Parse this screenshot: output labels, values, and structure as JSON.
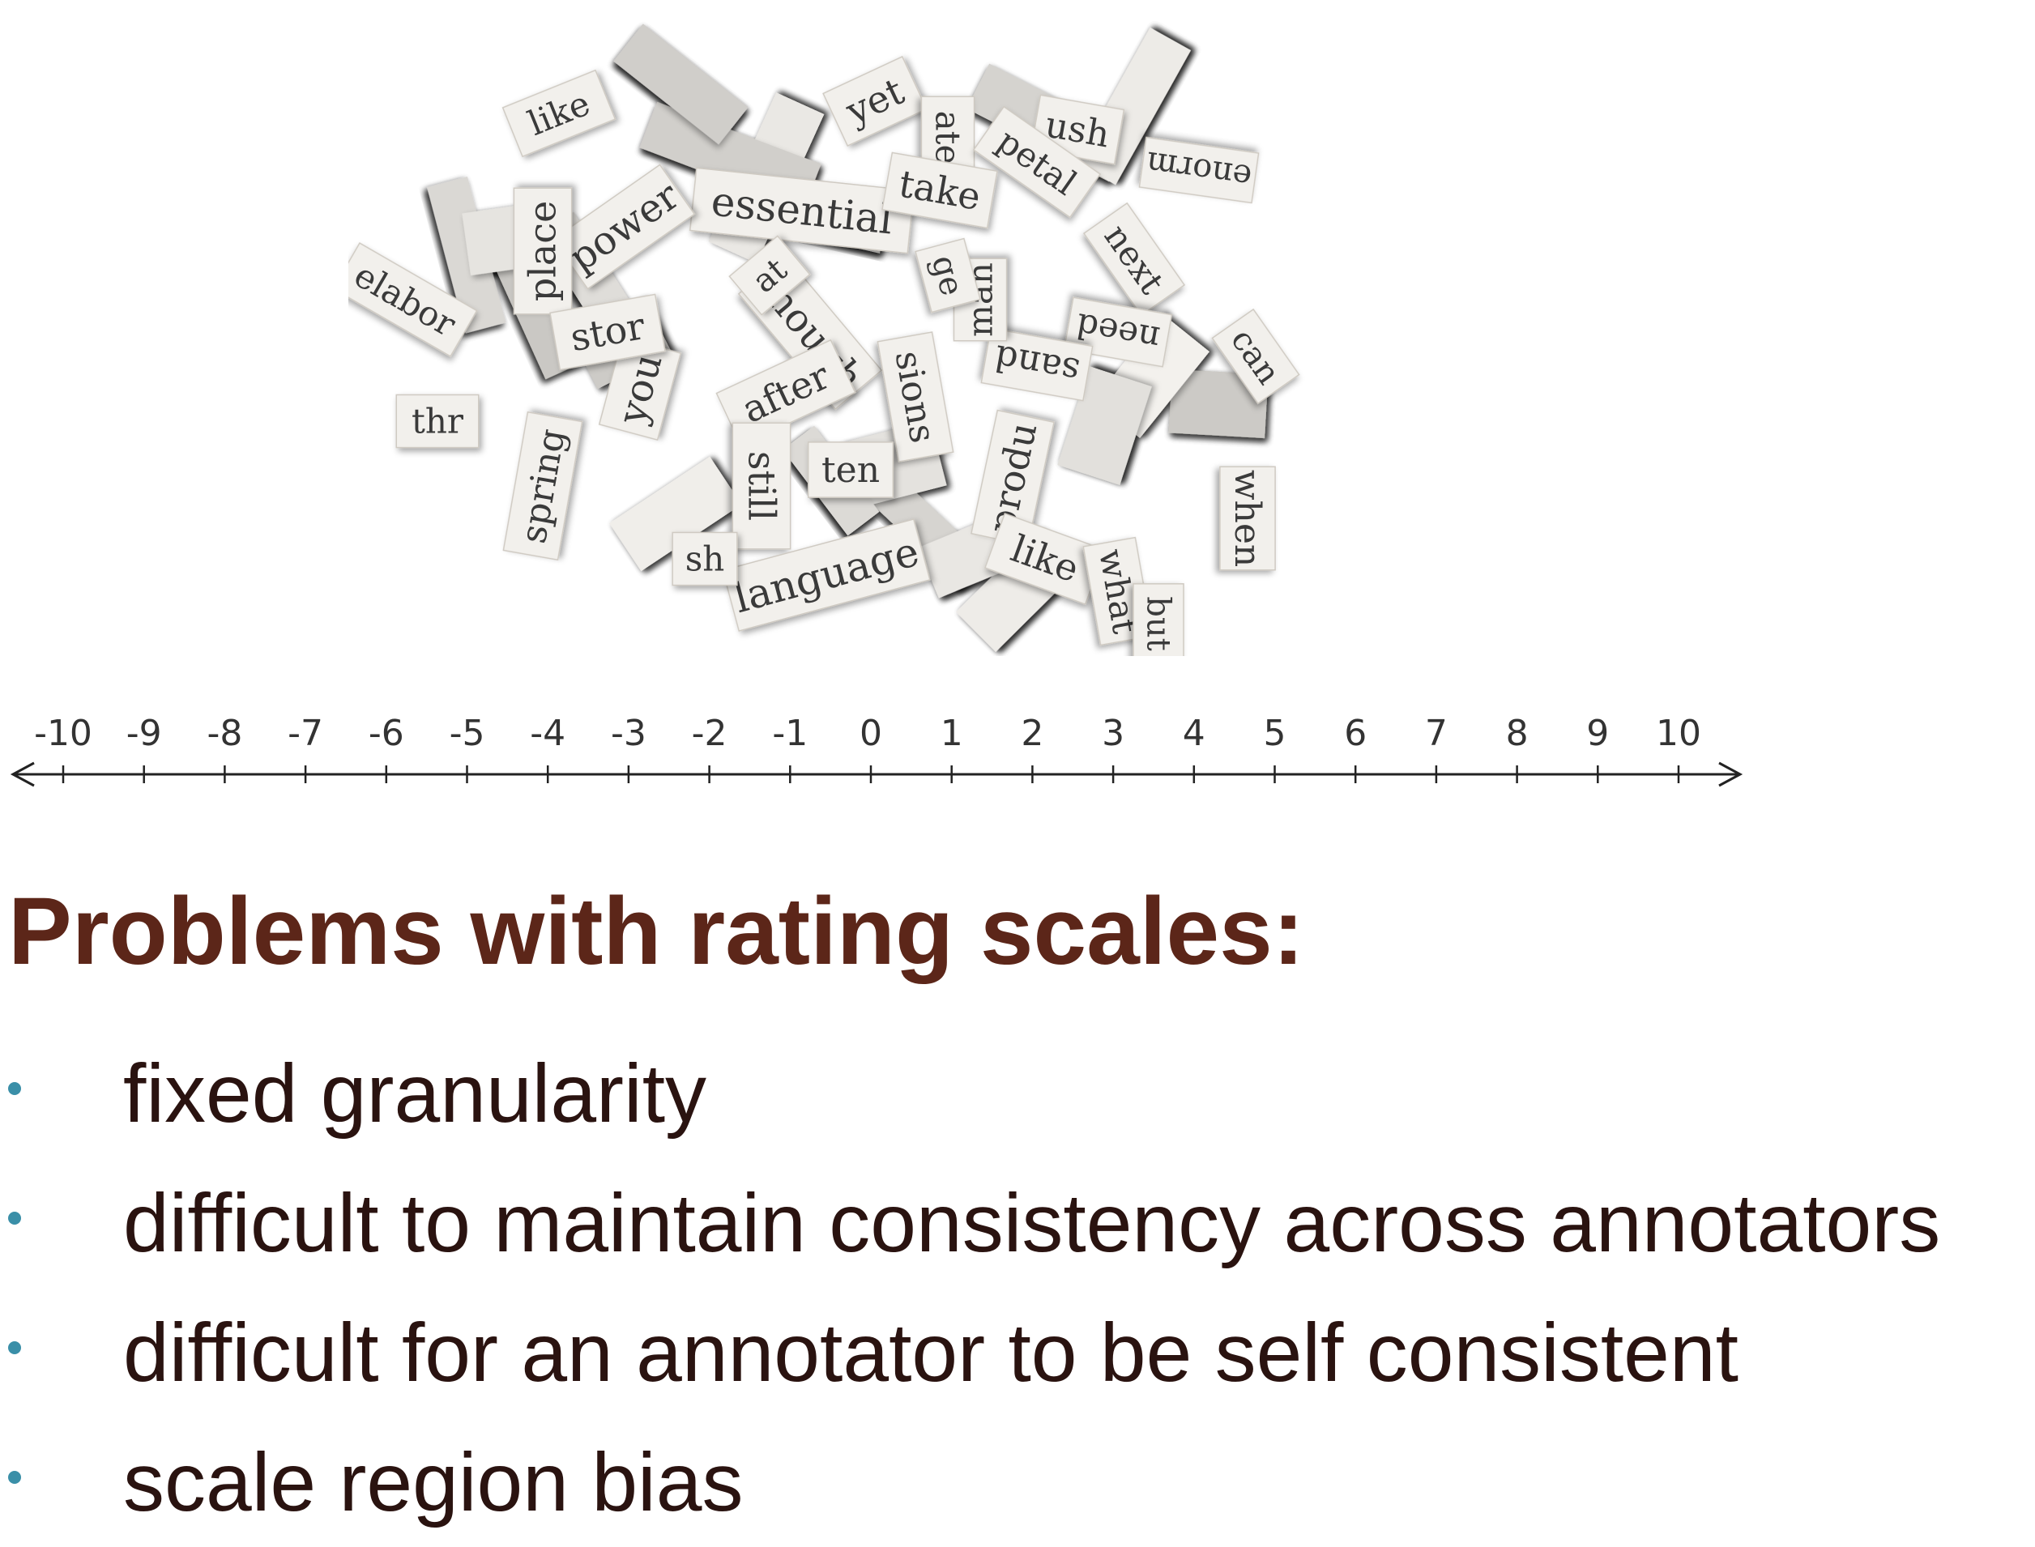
{
  "image": {
    "words": [
      "yet",
      "like",
      "ush",
      "ate",
      "petal",
      "enorm",
      "essential",
      "take",
      "power",
      "place",
      "next",
      "need",
      "can",
      "elabor",
      "though",
      "at",
      "you",
      "stor",
      "after",
      "sions",
      "sand",
      "man",
      "ten",
      "still",
      "produ",
      "when",
      "ge",
      "spring",
      "language",
      "like",
      "what",
      "but",
      "sh",
      "thr"
    ]
  },
  "number_line": {
    "ticks": [
      "-10",
      "-9",
      "-8",
      "-7",
      "-6",
      "-5",
      "-4",
      "-3",
      "-2",
      "-1",
      "0",
      "1",
      "2",
      "3",
      "4",
      "5",
      "6",
      "7",
      "8",
      "9",
      "10"
    ]
  },
  "title": "Problems with rating scales:",
  "bullets": [
    "fixed granularity",
    "difficult to maintain consistency across annotators",
    "difficult for an annotator to be self consistent",
    "scale region bias"
  ],
  "colors": {
    "title": "#5c2619",
    "text": "#2a1310",
    "bullet": "#3a8fa8",
    "paper": "#f2f0ec",
    "ink": "#3a3a3a"
  }
}
